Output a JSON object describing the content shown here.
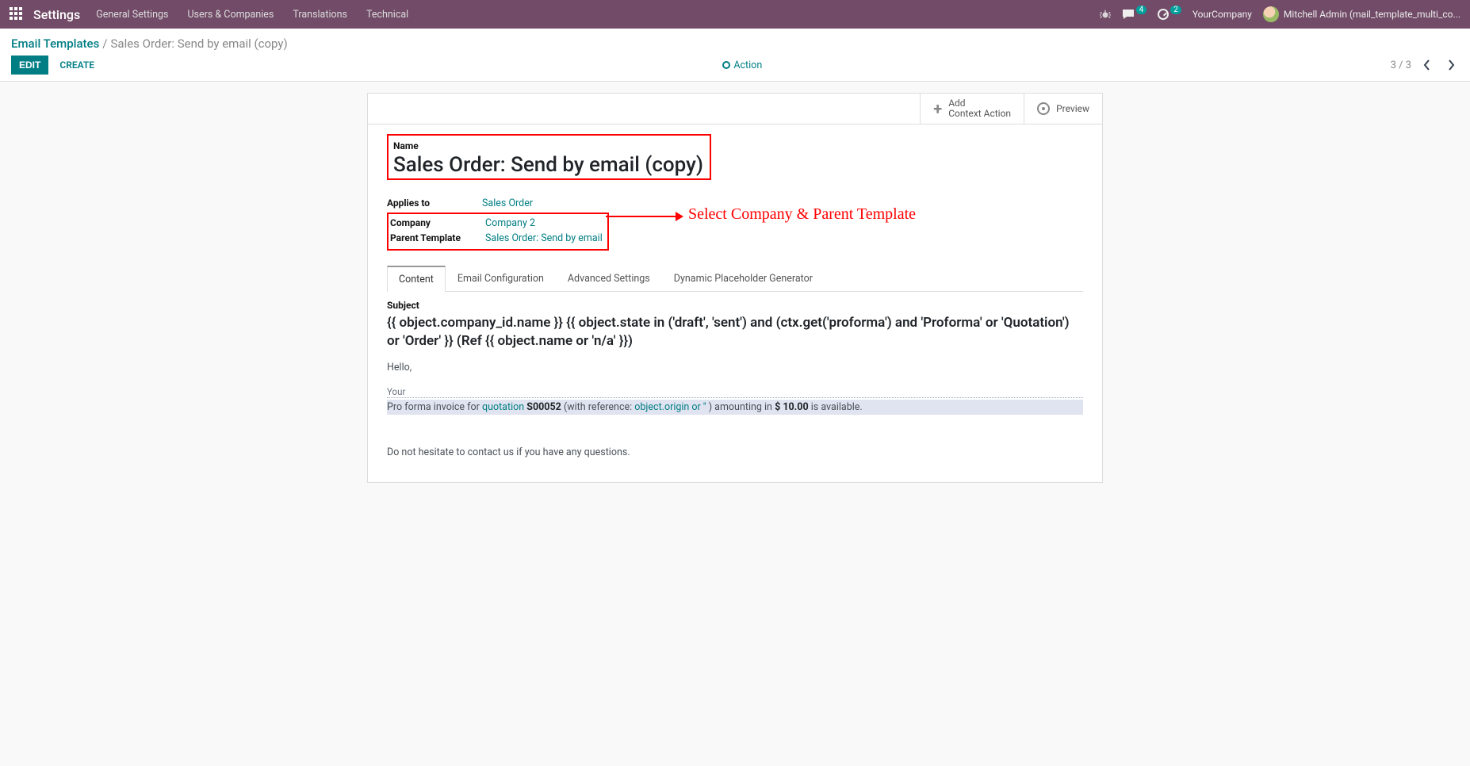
{
  "navbar": {
    "brand": "Settings",
    "menus": [
      "General Settings",
      "Users & Companies",
      "Translations",
      "Technical"
    ],
    "chat_badge": "4",
    "activity_badge": "2",
    "company": "YourCompany",
    "user": "Mitchell Admin (mail_template_multi_co..."
  },
  "breadcrumb": {
    "root": "Email Templates",
    "current": "Sales Order: Send by email (copy)"
  },
  "controls": {
    "edit": "EDIT",
    "create": "CREATE",
    "action": "Action",
    "pager": "3 / 3"
  },
  "statusbar": {
    "add_context_line1": "Add",
    "add_context_line2": "Context Action",
    "preview": "Preview"
  },
  "form": {
    "name_label": "Name",
    "name_value": "Sales Order: Send by email (copy)",
    "applies_to_label": "Applies to",
    "applies_to_value": "Sales Order",
    "company_label": "Company",
    "company_value": "Company 2",
    "parent_label": "Parent Template",
    "parent_value": "Sales Order: Send by email"
  },
  "annotation": "Select Company & Parent Template",
  "tabs": [
    "Content",
    "Email Configuration",
    "Advanced Settings",
    "Dynamic Placeholder Generator"
  ],
  "content": {
    "subject_label": "Subject",
    "subject_value": "{{ object.company_id.name }} {{ object.state in ('draft', 'sent') and (ctx.get('proforma') and 'Proforma' or 'Quotation') or 'Order' }} (Ref {{ object.name or 'n/a' }})",
    "hello": "Hello,",
    "your": "Your",
    "line_prefix": "Pro forma invoice for ",
    "quotation_word": "quotation",
    "quotation_ref": " S00052 ",
    "ref_prefix": "(with reference: ",
    "ref_link": "object.origin or '' ",
    "ref_suffix": ") amounting in ",
    "amount": "$ 10.00",
    "amount_suffix": " is available.",
    "footer": "Do not hesitate to contact us if you have any questions."
  }
}
